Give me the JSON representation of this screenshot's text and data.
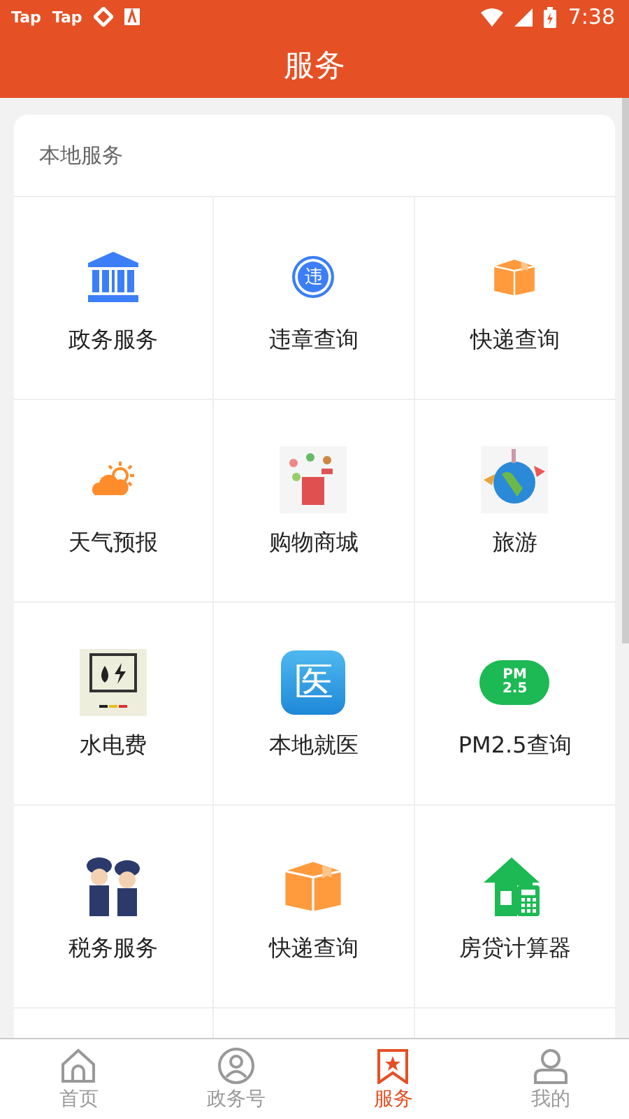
{
  "status_bar": {
    "apps": [
      "Tap",
      "Tap"
    ],
    "time": "7:38"
  },
  "header": {
    "title": "服务"
  },
  "section": {
    "title": "本地服务",
    "items": [
      {
        "label": "政务服务",
        "kind": "icon"
      },
      {
        "label": "违章查询",
        "kind": "icon",
        "icon_text": "违"
      },
      {
        "label": "快递查询",
        "kind": "icon"
      },
      {
        "label": "天气预报",
        "kind": "icon"
      },
      {
        "label": "购物商城",
        "kind": "picture"
      },
      {
        "label": "旅游",
        "kind": "picture"
      },
      {
        "label": "水电费",
        "kind": "picture"
      },
      {
        "label": "本地就医",
        "kind": "icon",
        "icon_text": "医"
      },
      {
        "label": "PM2.5查询",
        "kind": "icon",
        "icon_text": "PM 2.5"
      },
      {
        "label": "税务服务",
        "kind": "picture"
      },
      {
        "label": "快递查询",
        "kind": "icon"
      },
      {
        "label": "房贷计算器",
        "kind": "icon"
      }
    ]
  },
  "tab_bar": [
    {
      "label": "首页",
      "selected": false
    },
    {
      "label": "政务号",
      "selected": false
    },
    {
      "label": "服务",
      "selected": true
    },
    {
      "label": "我的",
      "selected": false
    }
  ]
}
